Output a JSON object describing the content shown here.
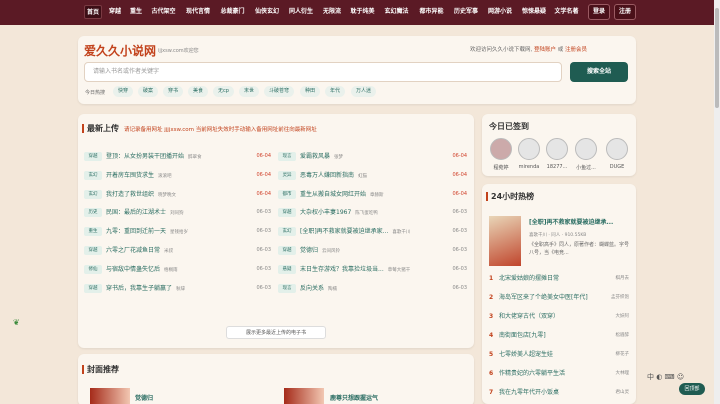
{
  "nav": {
    "items": [
      "首页",
      "穿越",
      "重生",
      "古代架空",
      "现代言情",
      "总裁豪门",
      "仙侠玄幻",
      "同人衍生",
      "无限流",
      "耽于纯美",
      "玄幻魔法",
      "都市异能",
      "历史军事",
      "网游小说",
      "惊悚悬疑",
      "文学名著"
    ],
    "login": "登录",
    "register": "注册"
  },
  "header": {
    "logo": "爱久久小说网",
    "logo_sub": "ijjxsw.com欢迎您",
    "welcome_prefix": "欢迎访问久久小说下载网,",
    "welcome_login": "登陆账户",
    "welcome_or": "或",
    "welcome_register": "注册会员",
    "search_placeholder": "请输入书名或作者关键字",
    "search_button": "搜索全站",
    "tags_label": "今日热搜",
    "tags": [
      "快穿",
      "破案",
      "穿书",
      "美食",
      "无cp",
      "末世",
      "斗破苍穹",
      "种田",
      "年代",
      "万人迷"
    ]
  },
  "latest": {
    "title": "最新上传",
    "notice": "请记录备用网址 jjjjxsw.com 当前网址失效时手动输入备用网址前往向最新网址",
    "more": "展示更多最近上传的电子书",
    "rows": [
      {
        "tag": "穿越",
        "title": "登顶：从女扮男装干团播开始",
        "author": "醉翠食",
        "date": "06-04",
        "red": true
      },
      {
        "tag": "现言",
        "title": "爱霸救风暴",
        "author": "张梦",
        "date": "06-04",
        "red": true
      },
      {
        "tag": "玄幻",
        "title": "开着房车囤货求生",
        "author": "滚滚吧",
        "date": "06-04",
        "red": true
      },
      {
        "tag": "灵异",
        "title": "恶毒万人嫌回新指南",
        "author": "虹猫",
        "date": "06-04",
        "red": true
      },
      {
        "tag": "玄幻",
        "title": "我打造了救世组织",
        "author": "晓梦晚文",
        "date": "06-04",
        "red": true
      },
      {
        "tag": "都市",
        "title": "重生从搬自城女网红开始",
        "author": "章赫斯",
        "date": "06-04",
        "red": true
      },
      {
        "tag": "历史",
        "title": "民国：最后的江湖术士",
        "author": "刘同狗",
        "date": "06-03",
        "red": false
      },
      {
        "tag": "穿越",
        "title": "大杂权小丰妻1967",
        "author": "陈飞蛋吃鸭",
        "date": "06-03",
        "red": false
      },
      {
        "tag": "重生",
        "title": "九零：重回到迁前一天",
        "author": "星钱拾岁",
        "date": "06-03",
        "red": false
      },
      {
        "tag": "玄幻",
        "title": "[全职]再不救家就要被迫继承家...",
        "author": "喜歌千川",
        "date": "06-03",
        "red": false
      },
      {
        "tag": "穿越",
        "title": "六零之厂花减鱼日常",
        "author": "米叔",
        "date": "06-03",
        "red": false
      },
      {
        "tag": "穿越",
        "title": "觉德归",
        "author": "云间风铃",
        "date": "06-03",
        "red": false
      },
      {
        "tag": "修仙",
        "title": "与宿敌中情蛊失忆后",
        "author": "梧桐雨",
        "date": "06-03",
        "red": false
      },
      {
        "tag": "悬疑",
        "title": "末日生存游戏？我靠捡垃圾当...",
        "author": "草莓大猪干",
        "date": "06-03",
        "red": false
      },
      {
        "tag": "穿越",
        "title": "穿书后，我靠生子躺赢了",
        "author": "秋辞",
        "date": "06-03",
        "red": false
      },
      {
        "tag": "现言",
        "title": "反向关系",
        "author": "陶楠",
        "date": "06-03",
        "red": false
      }
    ]
  },
  "signin": {
    "title": "今日已签到",
    "users": [
      "程菀婷",
      "mirenda",
      "18277...",
      "小鱼过...",
      "DUGE"
    ]
  },
  "hot": {
    "title": "24小时热榜",
    "book_title": "[全职]再不救家就要被迫继承...",
    "book_meta": "喜歌千川 · 同人 · 910.55KB",
    "book_desc": "《全职高手》同人，原著作者：蝴蝶蓝。字号八号，当《电竞...",
    "items": [
      {
        "n": "1",
        "title": "北宋爱姑娘的摆摊日常",
        "author": "棋月去"
      },
      {
        "n": "2",
        "title": "海岛军区来了个绝美女中医[年代]",
        "author": "孟芬织饱"
      },
      {
        "n": "3",
        "title": "和大佬穿古代（双穿）",
        "author": "大妖阿"
      },
      {
        "n": "4",
        "title": "南街面包店[九零]",
        "author": "松眉醉"
      },
      {
        "n": "5",
        "title": "七零娇美人超宠生娃",
        "author": "柳花子"
      },
      {
        "n": "6",
        "title": "作精贵妃的六零躺平生活",
        "author": "大林哩"
      },
      {
        "n": "7",
        "title": "我在九零年代开小饭桌",
        "author": "君山灵"
      }
    ]
  },
  "covers": {
    "title": "封面推荐",
    "items": [
      "觉德归",
      "鹿尊只想跟握运气"
    ]
  },
  "float": {
    "label": "回顶部"
  },
  "ime": "中 ◐ ⌨ ☺"
}
